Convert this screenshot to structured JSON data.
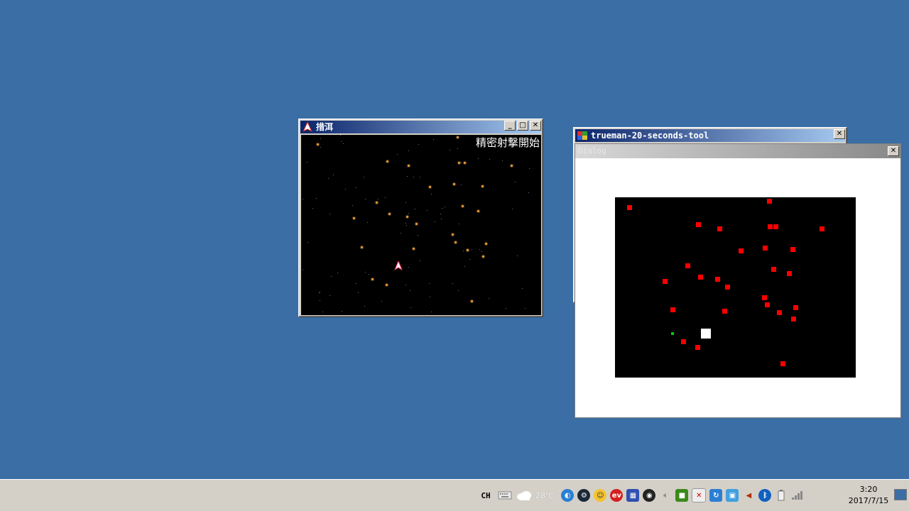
{
  "colors": {
    "desktop": "#3a6ea5",
    "title_active": "#0a246a",
    "enemy_bullet": "#ff9933",
    "tool_red": "#ff0000",
    "tool_green": "#00cc00",
    "taskbar": "#d4d0c8"
  },
  "game_window": {
    "title": "措洱",
    "icon": "ship-icon",
    "overlay_text": "精密射撃開始",
    "buttons": {
      "minimize": "_",
      "maximize": "□",
      "close": "✕"
    }
  },
  "tool_window": {
    "title": "trueman-20-seconds-tool",
    "close": "✕"
  },
  "dialog_window": {
    "title": "Dialog",
    "close": "✕"
  },
  "game_objects": {
    "bullets_px": [],
    "player": "ship"
  },
  "radar": {
    "description_units": "canvas fraction"
  },
  "taskbar": {
    "language": "CH",
    "weather_temp": "28℃",
    "weather_icon": "cloud-icon",
    "tray_icons": [
      "shield-icon",
      "steam-icon",
      "mascot-icon",
      "ev-icon",
      "grid-icon",
      "speed-icon",
      "volume-outline-icon",
      "nvidia-icon",
      "blocked-icon",
      "update-icon",
      "network-manager-icon",
      "volume-icon",
      "bluetooth-icon",
      "battery-icon",
      "signal-icon"
    ],
    "clock_time": "3:20",
    "clock_date": "2017/7/15"
  }
}
